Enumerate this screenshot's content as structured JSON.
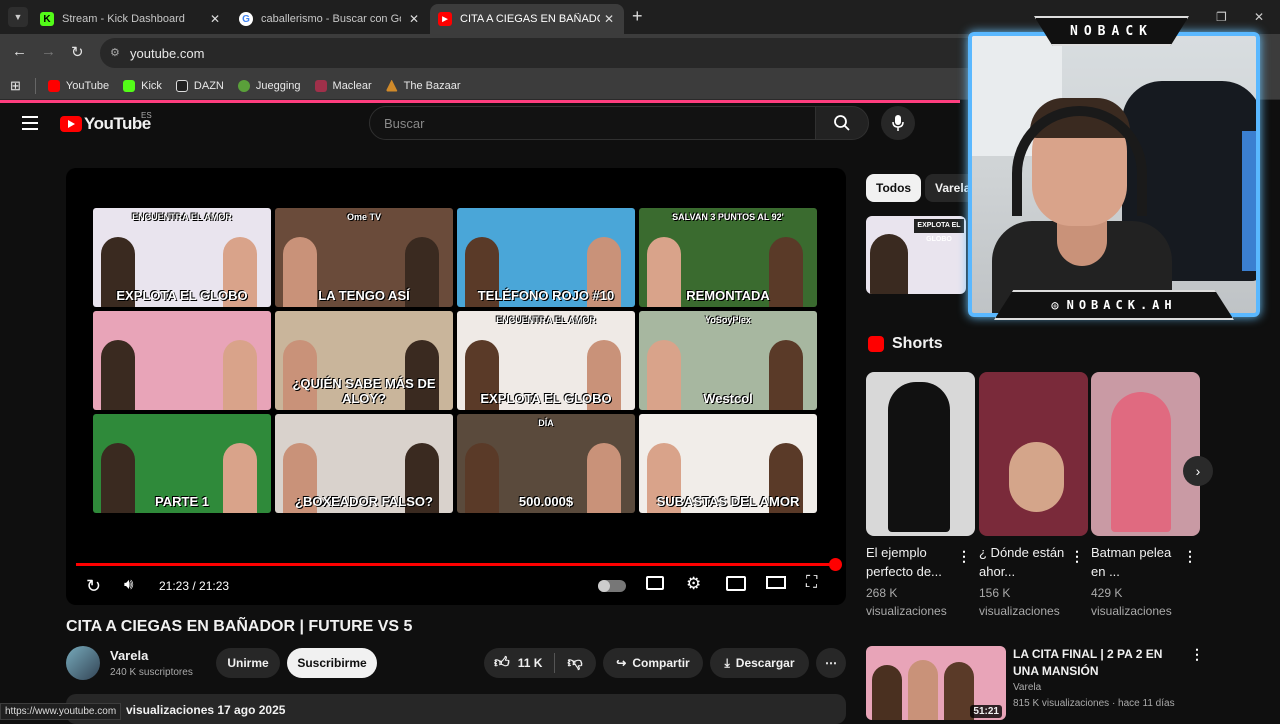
{
  "browser": {
    "tabs": [
      {
        "title": "Stream - Kick Dashboard",
        "active": false
      },
      {
        "title": "caballerismo - Buscar con Goog",
        "active": false
      },
      {
        "title": "CITA A CIEGAS EN BAÑADOR | F",
        "active": true
      }
    ],
    "url": "youtube.com",
    "bookmarks": [
      "YouTube",
      "Kick",
      "DAZN",
      "Juegging",
      "Maclear",
      "The Bazaar"
    ],
    "status_url": "https://www.youtube.com"
  },
  "youtube": {
    "logo_text": "YouTube",
    "region": "ES",
    "search_placeholder": "Buscar"
  },
  "player": {
    "time": "21:23 / 21:23",
    "progress": 1.0,
    "thumbs": [
      {
        "caption": "EXPLOTA EL GLOBO",
        "sub": "ENCUENTRA EL AMOR",
        "bg": "#e9e4ee"
      },
      {
        "caption": "LA TENGO ASÍ",
        "sub": "Ome TV",
        "bg": "#6a4b3a"
      },
      {
        "caption": "TELÉFONO ROJO #10",
        "sub": "",
        "bg": "#4aa6d8"
      },
      {
        "caption": "REMONTADA",
        "sub": "SALVAN 3 PUNTOS AL 92'",
        "bg": "#3a6b2f"
      },
      {
        "caption": "",
        "sub": "",
        "bg": "#e8a4b8"
      },
      {
        "caption": "¿QUIÉN SABE MÁS DE ALOY?",
        "sub": "",
        "bg": "#c9b59b"
      },
      {
        "caption": "EXPLOTA EL GLOBO",
        "sub": "ENCUENTRA EL AMOR",
        "bg": "#efeae6"
      },
      {
        "caption": "Westcol",
        "sub": "YoSoyPlex",
        "bg": "#a7b7a0"
      },
      {
        "caption": "PARTE 1",
        "sub": "",
        "bg": "#2f8a3a"
      },
      {
        "caption": "¿BOXEADOR FALSO?",
        "sub": "",
        "bg": "#d9d2cc"
      },
      {
        "caption": "500.000$",
        "sub": "DÍA",
        "bg": "#5a4a3c"
      },
      {
        "caption": "SUBASTAS DEL AMOR",
        "sub": "",
        "bg": "#f1ede9"
      }
    ]
  },
  "video": {
    "title": "CITA A CIEGAS EN BAÑADOR | FUTURE VS 5",
    "channel": "Varela",
    "subscribers": "240 K suscriptores",
    "unsubscribe_label": "Unirme",
    "subscribe_label": "Suscribirme",
    "likes": "11 K",
    "share_label": "Compartir",
    "download_label": "Descargar",
    "views_date": "visualizaciones  17 ago 2025"
  },
  "sidebar": {
    "chips": [
      "Todos",
      "Varela"
    ],
    "shorts_label": "Shorts",
    "shorts": [
      {
        "title": "El ejemplo perfecto de...",
        "views": "268 K visualizaciones",
        "bg": "#d8d8d8"
      },
      {
        "title": "¿ Dónde están ahor...",
        "views": "156 K visualizaciones",
        "bg": "#7a2a3a"
      },
      {
        "title": "Batman pelea en ...",
        "views": "429 K visualizaciones",
        "bg": "#c99aa4"
      }
    ],
    "recommended": {
      "title": "LA CITA FINAL | 2 PA 2 EN UNA MANSIÓN",
      "channel": "Varela",
      "meta": "815 K visualizaciones · hace 11 días",
      "duration": "51:21"
    }
  },
  "webcam": {
    "name": "NOBACK",
    "handle": "NOBACK.AH",
    "accent": "#5ab8ff"
  }
}
